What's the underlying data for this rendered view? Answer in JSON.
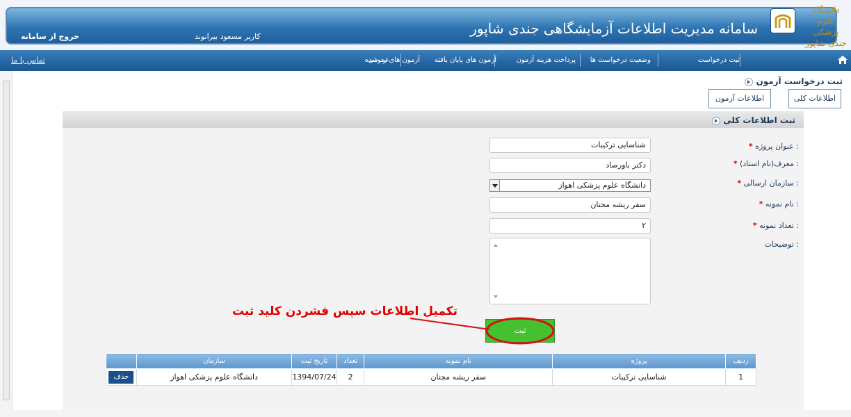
{
  "header": {
    "system_title": "سامانه مدیریت اطلاعات آزمایشگاهی جندی شاپور",
    "university_logo_text": "دانشگاه علوم پزشکی جندی شاپور اهواز",
    "user_label": "کاربر مسعود بیرانوند",
    "exit_label": "خروج از سامانه"
  },
  "nav": {
    "contact_label": "تماس با ما",
    "items": [
      "ثبت درخواست",
      "وضعیت درخواست ها",
      "پرداخت هزینه آزمون",
      "آزمون های پایان یافته",
      "آزمون های رد شده",
      "عمومی"
    ]
  },
  "page": {
    "section_title": "ثبت درخواست آزمون",
    "tabs": [
      "اطلاعات کلی",
      "اطلاعات آزمون"
    ],
    "form_title": "ثبت اطلاعات کلی"
  },
  "form": {
    "fields": [
      {
        "label": "عنوان پروژه :",
        "value": "شناسایی ترکیبات"
      },
      {
        "label": "معرف(نام استاد) :",
        "value": "دکتر باورصاد"
      },
      {
        "label": "سازمان ارسالی :",
        "value": "دانشگاه علوم پزشکی اهواز"
      },
      {
        "label": "نام نمونه :",
        "value": "سفر ریشه مجتان"
      },
      {
        "label": "تعداد نمونه :",
        "value": "۲"
      },
      {
        "label": "توضیحات :",
        "value": ""
      }
    ],
    "required_mark": "*",
    "submit_label": "ثبت"
  },
  "annotation": {
    "text": "تکمیل اطلاعات سپس فشردن کلید ثبت",
    "color": "#e00000"
  },
  "grid": {
    "columns": [
      "ردیف",
      "پروژه",
      "نام نمونه",
      "تعداد",
      "تاریخ ثبت",
      "سازمان",
      ""
    ],
    "rows": [
      {
        "index": "1",
        "project": "شناسایی ترکیبات",
        "sample_name": "سفر ریشه مجتان",
        "count": "2",
        "date": "1394/07/24",
        "organization": "دانشگاه علوم پزشکی اهواز",
        "action": "حذف"
      }
    ]
  },
  "colors": {
    "header_blue": "#2f75b3",
    "nav_blue": "#2565a2",
    "submit_green": "#45c12f",
    "table_header": "#5d96cf",
    "required_red": "#e00000"
  }
}
